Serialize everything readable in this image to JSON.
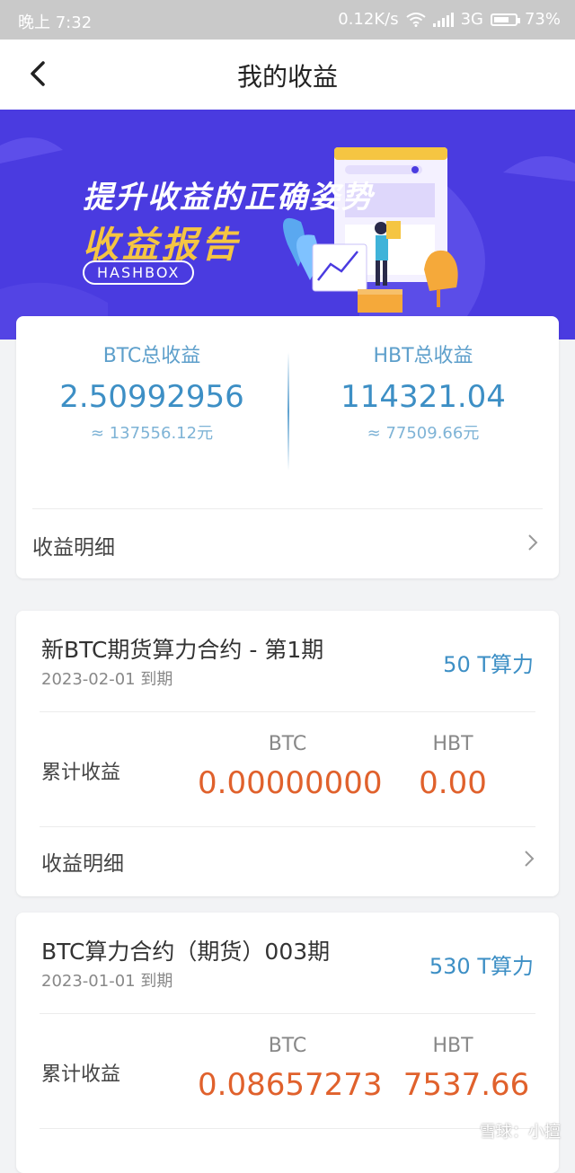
{
  "status_bar": {
    "time": "晚上 7:32",
    "network_speed": "0.12K/s",
    "network_type": "3G",
    "battery": "73%",
    "battery_level": 0.73
  },
  "nav": {
    "back_icon": "chevron-left-icon",
    "title": "我的收益"
  },
  "banner": {
    "line1": "提升收益的正确姿势",
    "line2": "收益报告",
    "brand": "HASHBOX"
  },
  "summary": {
    "btc": {
      "label": "BTC总收益",
      "amount": "2.50992956",
      "fiat": "≈ 137556.12元"
    },
    "hbt": {
      "label": "HBT总收益",
      "amount": "114321.04",
      "fiat": "≈ 77509.66元"
    },
    "detail_label": "收益明细"
  },
  "contracts": [
    {
      "name": "新BTC期货算力合约 - 第1期",
      "expiry": "2023-02-01 到期",
      "hashrate": "50 T算力",
      "accum_label": "累计收益",
      "btc_header": "BTC",
      "hbt_header": "HBT",
      "btc_value": "0.00000000",
      "hbt_value": "0.00",
      "detail_label": "收益明细"
    },
    {
      "name": "BTC算力合约（期货）003期",
      "expiry": "2023-01-01 到期",
      "hashrate": "530 T算力",
      "accum_label": "累计收益",
      "btc_header": "BTC",
      "hbt_header": "HBT",
      "btc_value": "0.08657273",
      "hbt_value": "7537.66"
    }
  ],
  "watermark": "雪球：小擅",
  "colors": {
    "accent_blue": "#3d8fc5",
    "value_orange": "#e0612c",
    "banner_bg": "#4a3be0",
    "banner_yellow": "#f5c542"
  }
}
